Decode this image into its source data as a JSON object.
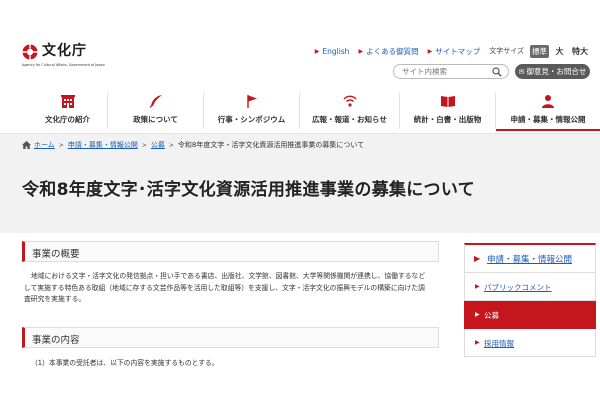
{
  "logo": {
    "name": "文化庁",
    "sub": "Agency for Cultural Affairs, Government of Japan"
  },
  "utility": {
    "links": [
      "English",
      "よくある御質問",
      "サイトマップ"
    ],
    "font_size_label": "文字サイズ",
    "font_sizes": [
      "標準",
      "大",
      "特大"
    ]
  },
  "search": {
    "placeholder": "サイト内検索",
    "icon": "search-icon"
  },
  "contact_button": "御意見・お問合せ",
  "global_nav": [
    {
      "label": "文化庁の紹介",
      "icon": "building-icon"
    },
    {
      "label": "政策について",
      "icon": "feather-icon"
    },
    {
      "label": "行事・シンポジウム",
      "icon": "flag-icon"
    },
    {
      "label": "広報・報道・お知らせ",
      "icon": "broadcast-icon"
    },
    {
      "label": "統計・白書・出版物",
      "icon": "book-icon"
    },
    {
      "label": "申請・募集・情報公開",
      "icon": "person-icon",
      "active": true
    }
  ],
  "breadcrumb": [
    "ホーム",
    "申請・募集・情報公開",
    "公募",
    "令和8年度文字・活字文化資源活用推進事業の募集について"
  ],
  "page_title": "令和8年度文字･活字文化資源活用推進事業の募集について",
  "sections": [
    {
      "heading": "事業の概要",
      "lines": [
        "地域における文字・活字文化の発信拠点・担い手である書店、出版社、文学館、図書館、大学等関係機関が連携し、協働するなど",
        "して実施する特色ある取組（地域に存する文芸作品等を活用した取組等）を支援し、文字・活字文化の振興モデルの構築に向けた調",
        "査研究を実施する。"
      ]
    },
    {
      "heading": "事業の内容",
      "lines": [
        "（1）本事業の受託者は、以下の内容を実施するものとする。"
      ]
    }
  ],
  "side_nav": {
    "title": "申請・募集・情報公開",
    "items": [
      {
        "label": "パブリックコメント",
        "active": false
      },
      {
        "label": "公募",
        "active": true
      },
      {
        "label": "採用情報",
        "active": false
      }
    ]
  },
  "colors": {
    "accent": "#c4161c",
    "link": "#1a5fb4"
  }
}
